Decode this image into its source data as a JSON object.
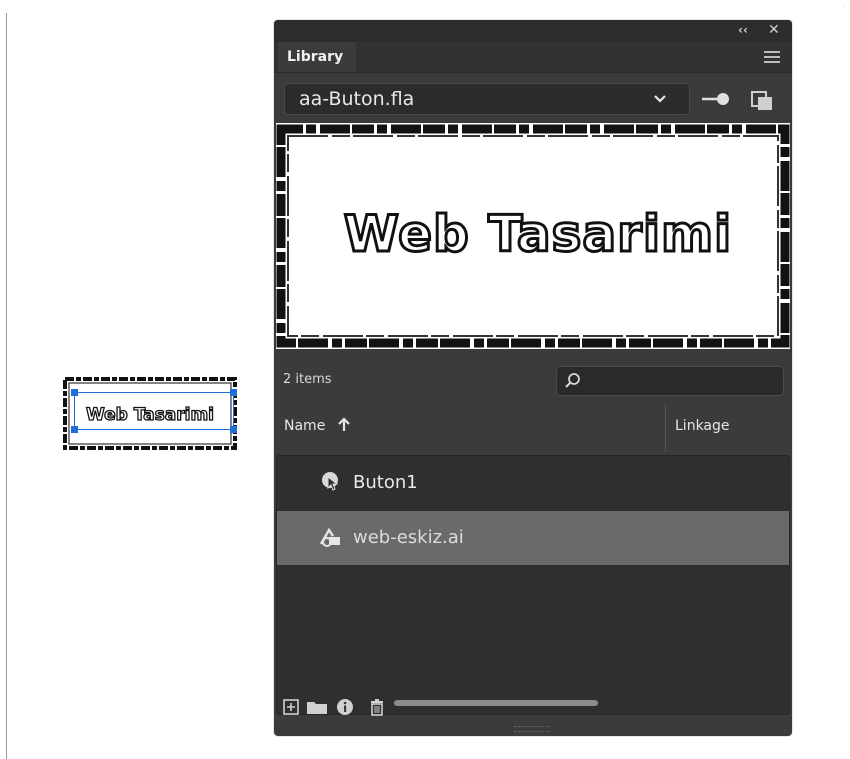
{
  "stage": {
    "instance_text": "Web Tasarimi"
  },
  "panel": {
    "tab_label": "Library",
    "document_select_value": "aa-Buton.fla",
    "preview_text": "Web Tasarimi",
    "items_count": "2 items",
    "search_placeholder": "",
    "columns": {
      "name": "Name",
      "linkage": "Linkage"
    },
    "items": [
      {
        "label": "Buton1",
        "icon": "button-symbol-icon",
        "selected": false
      },
      {
        "label": "web-eskiz.ai",
        "icon": "graphic-asset-icon",
        "selected": true
      }
    ],
    "bottom_icons": [
      "new-symbol-icon",
      "new-folder-icon",
      "properties-icon",
      "delete-icon"
    ]
  },
  "colors": {
    "panel_bg": "#3b3b3b",
    "selected_row": "#6a6a6a",
    "selection_blue": "#1e6fd9"
  }
}
